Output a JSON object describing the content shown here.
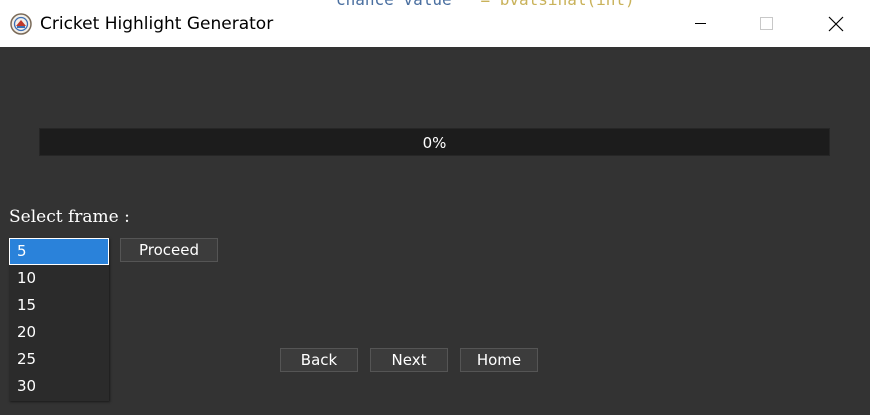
{
  "window": {
    "title": "Cricket Highlight Generator",
    "background_code": {
      "prefix": "chance value",
      "suffix": "= bvatsinal(int)"
    }
  },
  "progress": {
    "value": 0,
    "label": "0%"
  },
  "frame_select": {
    "label": "Select frame :",
    "options": [
      "5",
      "10",
      "15",
      "20",
      "25",
      "30"
    ],
    "selected": "5"
  },
  "buttons": {
    "proceed": "Proceed",
    "back": "Back",
    "next": "Next",
    "home": "Home"
  },
  "colors": {
    "background": "#333333",
    "accent": "#2a82da",
    "progress_track": "#1c1c1c"
  }
}
